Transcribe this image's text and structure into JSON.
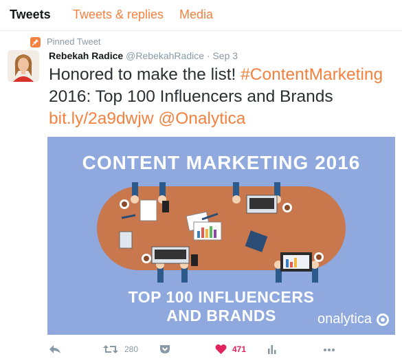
{
  "tabs": [
    {
      "label": "Tweets",
      "active": true
    },
    {
      "label": "Tweets & replies",
      "active": false
    },
    {
      "label": "Media",
      "active": false
    }
  ],
  "pinned": {
    "label": "Pinned Tweet"
  },
  "tweet": {
    "author_name": "Rebekah Radice",
    "handle": "@RebekahRadice",
    "separator": "·",
    "date": "Sep 3",
    "text_before": "Honored to make the list! ",
    "hashtag": "#ContentMarketing",
    "text_middle": " 2016: Top 100 Influencers and Brands",
    "link": "bit.ly/2a9dwjw",
    "mention": "@Onalytica"
  },
  "card": {
    "heading": "CONTENT MARKETING 2016",
    "subheading_line1": "TOP 100 INFLUENCERS",
    "subheading_line2": "AND BRANDS",
    "logo_text": "onalytica"
  },
  "actions": {
    "retweet_count": "280",
    "like_count": "471"
  },
  "colors": {
    "accent": "#f5813f",
    "like": "#e0245e",
    "muted": "#8899a6",
    "card_bg": "#8fa9df",
    "table": "#c8784c"
  }
}
